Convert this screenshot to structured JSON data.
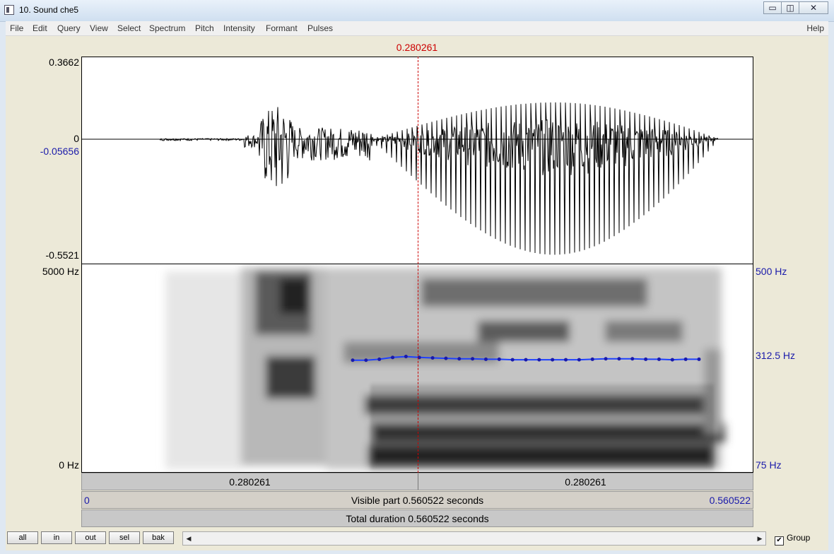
{
  "window": {
    "title": "10. Sound che5",
    "minimize": "▭",
    "maximize": "◫",
    "close": "✕"
  },
  "menu": [
    "File",
    "Edit",
    "Query",
    "View",
    "Select",
    "Spectrum",
    "Pitch",
    "Intensity",
    "Formant",
    "Pulses"
  ],
  "help": "Help",
  "cursor_time": "0.280261",
  "waveform": {
    "ymax": "0.3662",
    "zero": "0",
    "cursor_value": "-0.05656",
    "ymin": "-0.5521"
  },
  "spectrogram": {
    "fmax": "5000 Hz",
    "fmin": "0 Hz",
    "pitch_max": "500 Hz",
    "pitch_mid": "312.5 Hz",
    "pitch_min": "75 Hz"
  },
  "timebar": {
    "left": "0.280261",
    "right": "0.280261"
  },
  "visible": {
    "start": "0",
    "label": "Visible part 0.560522 seconds",
    "end": "0.560522"
  },
  "total": {
    "label": "Total duration 0.560522 seconds"
  },
  "buttons": {
    "all": "all",
    "in": "in",
    "out": "out",
    "sel": "sel",
    "bak": "bak"
  },
  "scroll": {
    "left_arrow": "◀",
    "right_arrow": "▶"
  },
  "group": {
    "label": "Group",
    "checked": "✔"
  },
  "pitch_track": [
    305,
    305,
    307,
    311,
    313,
    311,
    310,
    309,
    308,
    308,
    307,
    307,
    306,
    306,
    306,
    306,
    306,
    306,
    307,
    308,
    308,
    308,
    307,
    307,
    306,
    307,
    307
  ]
}
